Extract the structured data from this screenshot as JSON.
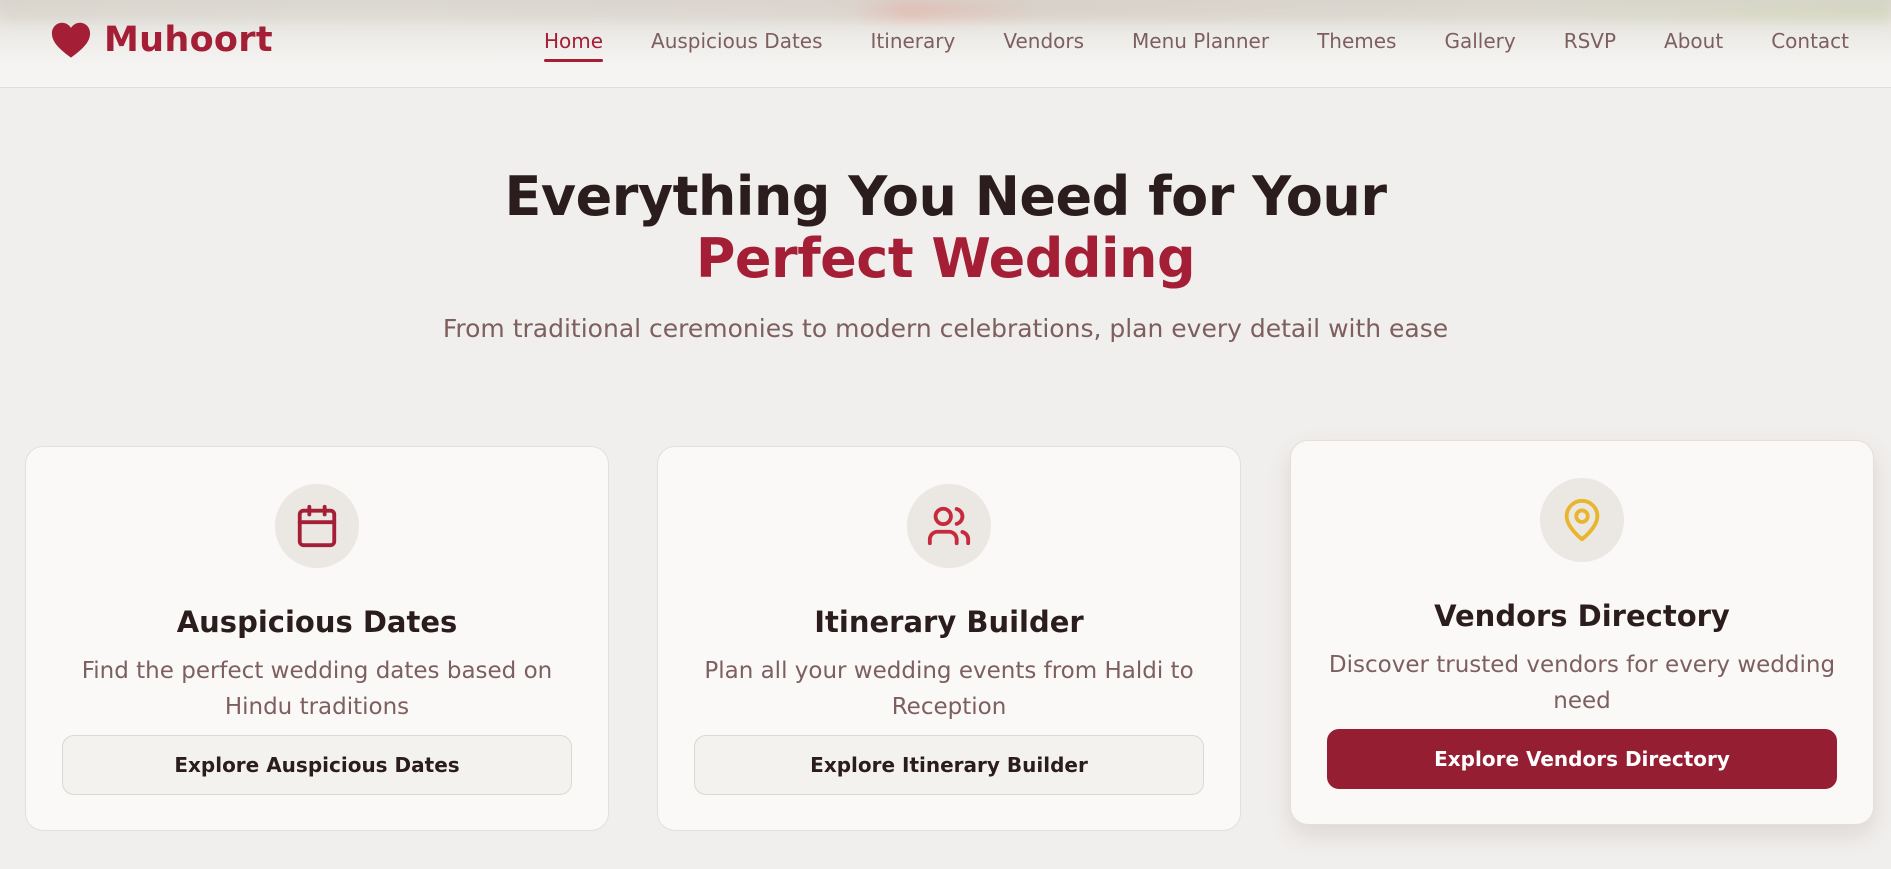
{
  "brand": {
    "name": "Muhoort",
    "icon": "heart-icon",
    "color": "#a41e35"
  },
  "nav": {
    "items": [
      {
        "label": "Home",
        "active": true
      },
      {
        "label": "Auspicious Dates",
        "active": false
      },
      {
        "label": "Itinerary",
        "active": false
      },
      {
        "label": "Vendors",
        "active": false
      },
      {
        "label": "Menu Planner",
        "active": false
      },
      {
        "label": "Themes",
        "active": false
      },
      {
        "label": "Gallery",
        "active": false
      },
      {
        "label": "RSVP",
        "active": false
      },
      {
        "label": "About",
        "active": false
      },
      {
        "label": "Contact",
        "active": false
      }
    ]
  },
  "hero": {
    "title_line1": "Everything You Need for Your",
    "title_line2": "Perfect Wedding",
    "subtitle": "From traditional ceremonies to modern celebrations, plan every detail with ease"
  },
  "features": [
    {
      "icon": "calendar-icon",
      "icon_color": "#a41e35",
      "title": "Auspicious Dates",
      "description": "Find the perfect wedding dates based on Hindu traditions",
      "button": "Explore Auspicious Dates"
    },
    {
      "icon": "users-icon",
      "icon_color": "#c62a3c",
      "title": "Itinerary Builder",
      "description": "Plan all your wedding events from Haldi to Reception",
      "button": "Explore Itinerary Builder"
    },
    {
      "icon": "map-pin-icon",
      "icon_color": "#e8b52c",
      "title": "Vendors Directory",
      "description": "Discover trusted vendors for every wedding need",
      "button": "Explore Vendors Directory"
    }
  ],
  "colors": {
    "accent": "#a41e35",
    "primary_button": "#961e33",
    "text_dark": "#2b1d1d",
    "text_muted": "#7d5f5f",
    "background": "#f1efed"
  }
}
